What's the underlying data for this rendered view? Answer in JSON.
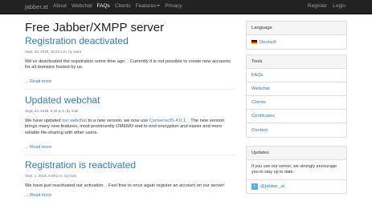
{
  "navbar": {
    "brand": "jabber.at",
    "links": [
      "About",
      "Webchat",
      "FAQs",
      "Clients",
      "Features",
      "Privacy"
    ],
    "right_links": [
      "Register",
      "Login"
    ]
  },
  "page_title": "Free Jabber/XMPP server",
  "posts": [
    {
      "title": "Registration deactivated",
      "meta": "Sept. 28, 2019, 10:23 a.m. by astra",
      "lines": [
        "We've deactivated the registration some time ago. . Currently it is not possible to create new accounts",
        "for all domains hosted by us."
      ],
      "read_more": "... Read more"
    },
    {
      "title": "Updated webchat",
      "meta": "Sept. 24, 2018, 6:42 p.m. by mati",
      "line1_before": "We have updated ",
      "line1_link1": "our webchat",
      "line1_mid": " to a new version, we now use ",
      "line1_link2": "ConverseJS 4.0.1",
      "line1_after": ". . The new version",
      "lines": [
        "brings many new features, most prominently OMEMO end to end encryption and easier and more",
        "reliable file-sharing with other users."
      ],
      "read_more": "... Read more"
    },
    {
      "title": "Registration is reactivated",
      "meta": "Sept. 1, 2018, 5:08 p.m. by mati",
      "line1": "We have just reactivated our activation. . Feel free to once again register an account on our server!",
      "read_more": "... Read more"
    }
  ],
  "sidebar": {
    "language": {
      "heading": "Language",
      "item": "Deutsch"
    },
    "tools": {
      "heading": "Tools",
      "items": [
        "FAQs",
        "Webchat",
        "Clients",
        "Certificates",
        "Contact"
      ]
    },
    "updates": {
      "heading": "Updates",
      "text": "If you use our server, we strongly encourage you to stay up to date.",
      "twitter": "@jabber_at"
    }
  }
}
